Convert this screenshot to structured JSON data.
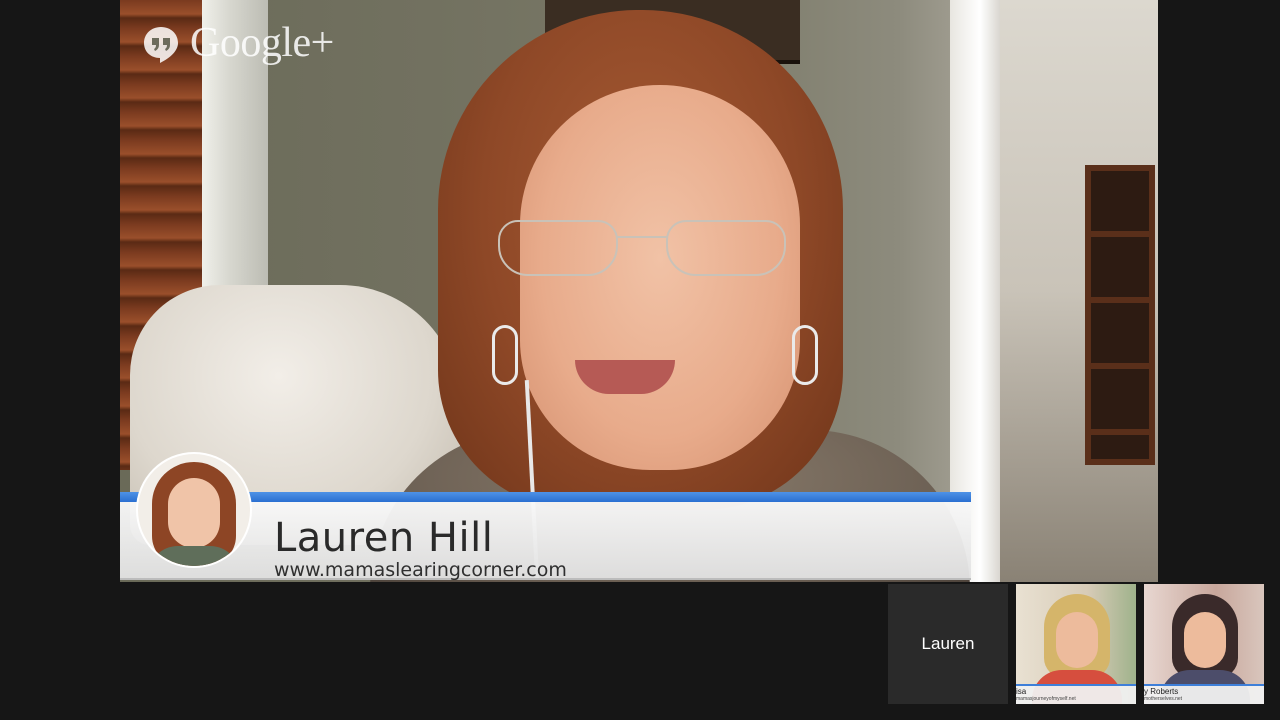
{
  "app": {
    "brand": "Google+",
    "brand_icon": "google-hangouts-quote-icon"
  },
  "main_video": {
    "lower_third": {
      "name": "Lauren Hill",
      "url": "www.mamaslearingcorner.com",
      "accent_color": "#3b82e0"
    }
  },
  "filmstrip": {
    "tiles": [
      {
        "label": "Lauren"
      },
      {
        "name_fragment": "isa",
        "url_fragment": "mamasjourneyofmyself.net"
      },
      {
        "name_fragment": "y Roberts",
        "url_fragment": "motherselves.net"
      }
    ]
  }
}
